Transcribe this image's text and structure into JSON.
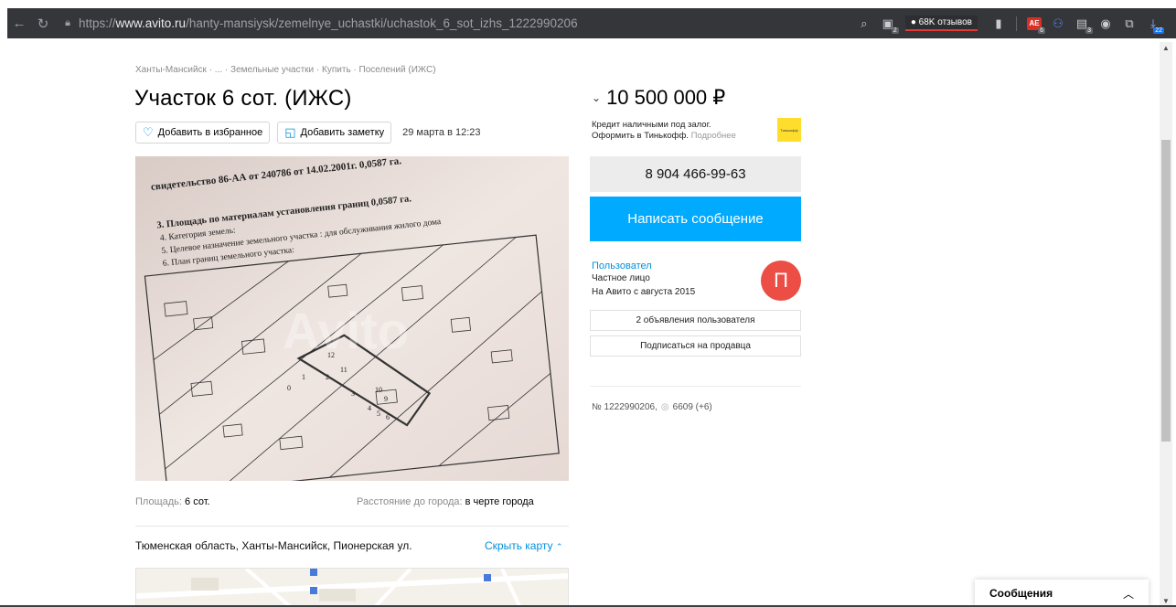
{
  "browser": {
    "url_scheme": "https://",
    "url_host": "www.avito.ru",
    "url_path": "/hanty-mansiysk/zemelnye_uchastki/uchastok_6_sot_izhs_1222990206",
    "reviews_label": "68K отзывов",
    "ext_badge_1": "2",
    "ext_ae_label": "AE",
    "ext_badge_2": "6",
    "ext_badge_3": "3",
    "download_badge": "22"
  },
  "breadcrumbs": "Ханты-Мансийск · ... · Земельные участки · Купить · Поселений (ИЖС)",
  "listing": {
    "title": "Участок 6 сот. (ИЖС)",
    "add_favorite": "Добавить в избранное",
    "add_note": "Добавить заметку",
    "date": "29 марта в 12:23",
    "area_label": "Площадь:",
    "area_value": "6 сот.",
    "distance_label": "Расстояние до города:",
    "distance_value": "в черте города",
    "address": "Тюменская область, Ханты-Мансийск, Пионерская ул.",
    "hide_map": "Скрыть карту"
  },
  "photo_doc": {
    "line1": "свидетельство 86-АА от 240786 от 14.02.2001г. 0,0587 га.",
    "line2": "3. Площадь по материалам установления границ 0,0587 га.",
    "line3": "4. Категория земель:",
    "line4": "5. Целевое назначение земельного участка : для обслуживания жилого дома",
    "line5": "6. План границ земельного участка:",
    "watermark": "Avito"
  },
  "sidebar": {
    "price": "10 500 000 ₽",
    "credit_line1": "Кредит наличными под залог.",
    "credit_line2": "Оформить в Тинькофф.",
    "credit_more": "Подробнее",
    "bank_logo_text": "Тинькофф",
    "phone": "8 904 466-99-63",
    "message_button": "Написать сообщение",
    "seller_name": "Пользовател",
    "seller_type": "Частное лицо",
    "seller_since": "На Авито с августа 2015",
    "avatar_letter": "П",
    "user_ads": "2 объявления пользователя",
    "subscribe": "Подписаться на продавца",
    "ad_number": "№ 1222990206,",
    "views": "6609 (+6)"
  },
  "messenger": {
    "label": "Сообщения"
  },
  "colors": {
    "accent": "#00aaff",
    "link": "#0091d9",
    "avatar": "#ec4e46",
    "toolbar": "#35363a"
  }
}
